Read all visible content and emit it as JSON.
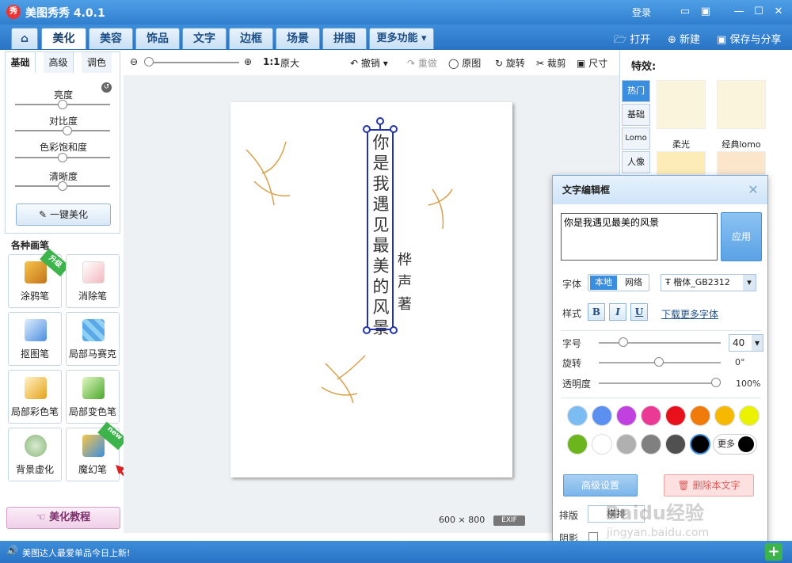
{
  "app": {
    "title": "美图秀秀 4.0.1",
    "logo_char": "秀",
    "login": "登录"
  },
  "tabs": [
    {
      "label": "美化"
    },
    {
      "label": "美容"
    },
    {
      "label": "饰品"
    },
    {
      "label": "文字"
    },
    {
      "label": "边框"
    },
    {
      "label": "场景"
    },
    {
      "label": "拼图"
    },
    {
      "label": "更多功能 ▾"
    }
  ],
  "topright": {
    "open": "打开",
    "new": "新建",
    "save": "保存与分享"
  },
  "toolbar": {
    "ratio": "1:1",
    "original_size": "原大",
    "undo": "撤销",
    "redo": "重做",
    "original": "原图",
    "rotate": "旋转",
    "crop": "裁剪",
    "size": "尺寸"
  },
  "left": {
    "tabs": [
      "基础",
      "高级",
      "调色"
    ],
    "sliders": [
      {
        "label": "亮度",
        "value": 50
      },
      {
        "label": "对比度",
        "value": 55
      },
      {
        "label": "色彩饱和度",
        "value": 50
      },
      {
        "label": "清晰度",
        "value": 50
      }
    ],
    "onekey": "一键美化",
    "brush_title": "各种画笔",
    "brushes": [
      {
        "label": "涂鸦笔",
        "badge": "升级"
      },
      {
        "label": "消除笔",
        "badge": ""
      },
      {
        "label": "抠图笔",
        "badge": ""
      },
      {
        "label": "局部马赛克",
        "badge": ""
      },
      {
        "label": "局部彩色笔",
        "badge": ""
      },
      {
        "label": "局部变色笔",
        "badge": ""
      },
      {
        "label": "背景虚化",
        "badge": ""
      },
      {
        "label": "魔幻笔",
        "badge": "new"
      }
    ],
    "tutorial": "美化教程"
  },
  "canvas": {
    "main_text": [
      "你",
      "是",
      "我",
      "遇",
      "见",
      "最",
      "美",
      "的",
      "风",
      "景"
    ],
    "author_text": [
      "桦",
      "声",
      "著"
    ],
    "dimensions": "600 × 800",
    "exif": "EXIF"
  },
  "effects": {
    "title": "特效:",
    "tabs": [
      "热门",
      "基础",
      "Lomo",
      "人像"
    ],
    "items": [
      {
        "label": "柔光"
      },
      {
        "label": "经典lomo"
      }
    ]
  },
  "dialog": {
    "title": "文字编辑框",
    "text": "你是我遇见最美的风景",
    "apply": "应用",
    "font_label": "字体",
    "font_local": "本地",
    "font_web": "网络",
    "font_name": "楷体_GB2312",
    "style_label": "样式",
    "download_fonts": "下载更多字体",
    "size_label": "字号",
    "size_value": "40",
    "rotate_label": "旋转",
    "rotate_value": "0°",
    "opacity_label": "透明度",
    "opacity_value": "100%",
    "more": "更多",
    "colors": [
      "#7bbcf2",
      "#5b8ff0",
      "#c041e0",
      "#ea3a96",
      "#e8101a",
      "#f07a0a",
      "#f7b800",
      "#eaf200",
      "#6cb51c",
      "#ffffff",
      "#b0b0b0",
      "#808080",
      "#505050",
      "#000000"
    ],
    "advanced": "高级设置",
    "delete": "删除本文字",
    "layout_label": "排版",
    "layout_value": "横排",
    "shadow_label": "阴影"
  },
  "bottom": {
    "news": "美图达人最爱单品今日上新!"
  },
  "watermark": {
    "text": "Baidu经验",
    "sub": "jingyan.baidu.com"
  }
}
